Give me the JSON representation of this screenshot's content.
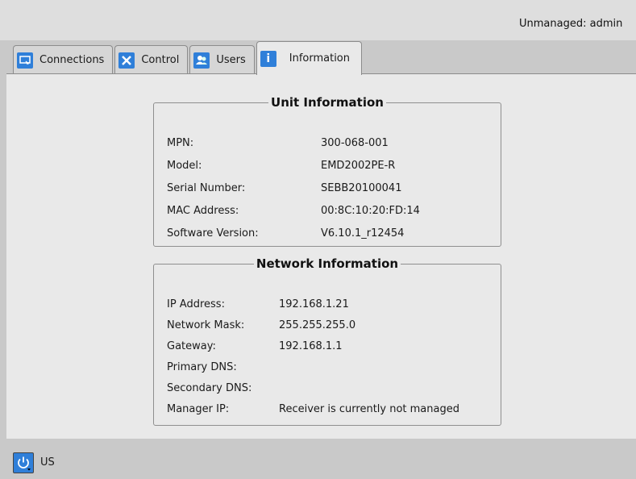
{
  "header": {
    "user_status": "Unmanaged: admin"
  },
  "tabs": [
    {
      "label": "Connections",
      "icon": "monitor-icon"
    },
    {
      "label": "Control",
      "icon": "tools-icon"
    },
    {
      "label": "Users",
      "icon": "users-icon"
    },
    {
      "label": "Information",
      "icon": "info-icon",
      "active": true
    }
  ],
  "unit_info": {
    "title": "Unit Information",
    "rows": [
      {
        "label": "MPN:",
        "value": "300-068-001"
      },
      {
        "label": "Model:",
        "value": "EMD2002PE-R"
      },
      {
        "label": "Serial Number:",
        "value": "SEBB20100041"
      },
      {
        "label": "MAC Address:",
        "value": "00:8C:10:20:FD:14"
      },
      {
        "label": "Software Version:",
        "value": "V6.10.1_r12454"
      }
    ]
  },
  "network_info": {
    "title": "Network Information",
    "rows": [
      {
        "label": "IP Address:",
        "value": "192.168.1.21"
      },
      {
        "label": "Network Mask:",
        "value": "255.255.255.0"
      },
      {
        "label": "Gateway:",
        "value": "192.168.1.1"
      },
      {
        "label": "Primary DNS:",
        "value": ""
      },
      {
        "label": "Secondary DNS:",
        "value": ""
      },
      {
        "label": "Manager IP:",
        "value": "Receiver is currently not managed"
      }
    ]
  },
  "footer": {
    "locale": "US",
    "power_icon": "power-icon"
  },
  "colors": {
    "accent": "#2f7fd9",
    "background": "#c9c9c9",
    "panel": "#e9e9e9"
  }
}
